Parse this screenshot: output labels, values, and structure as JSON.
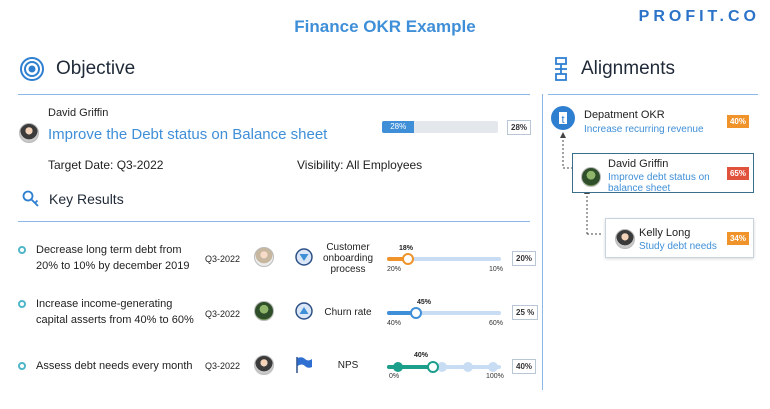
{
  "page": {
    "title": "Finance OKR Example",
    "logo": "PROFIT.CO"
  },
  "objective": {
    "section_label": "Objective",
    "owner": "David Griffin",
    "title": "Improve the Debt status on Balance sheet",
    "progress": 28,
    "progress_label": "28%",
    "progress_box": "28%",
    "target_date_label": "Target Date:",
    "target_date": "Q3-2022",
    "visibility_label": "Visibility:",
    "visibility": "All Employees"
  },
  "key_results": {
    "section_label": "Key Results",
    "items": [
      {
        "text": "Decrease long term debt from 20% to 10% by december 2019",
        "date": "Q3-2022",
        "icon": "arrow-down-circle-icon",
        "metric": "Customer onboarding process",
        "slider": {
          "value": 18,
          "value_label": "18%",
          "min_label": "20%",
          "max_label": "10%",
          "progress_fraction": 0.18,
          "color": "#f0932b"
        },
        "pct": "20%"
      },
      {
        "text": "Increase income-generating capital asserts from 40% to 60%",
        "date": "Q3-2022",
        "icon": "arrow-up-circle-icon",
        "metric": "Churn rate",
        "slider": {
          "value": 45,
          "value_label": "45%",
          "min_label": "40%",
          "max_label": "60%",
          "progress_fraction": 0.25,
          "color": "#3f8fd8"
        },
        "pct": "25 %"
      },
      {
        "text": "Assess debt needs every month",
        "date": "Q3-2022",
        "icon": "flag-icon",
        "metric": "NPS",
        "slider": {
          "value": 40,
          "value_label": "40%",
          "min_label": "0%",
          "max_label": "100%",
          "progress_fraction": 0.4,
          "color": "#1b9e8a"
        },
        "pct": "40%"
      }
    ]
  },
  "alignments": {
    "section_label": "Alignments",
    "items": [
      {
        "name": "Depatment OKR",
        "sub": "Increase recurring revenue",
        "badge": "40%",
        "badge_color": "#f0932b"
      },
      {
        "name": "David Griffin",
        "sub": "Improve debt status on balance sheet",
        "badge": "65%",
        "badge_color": "#e0523c"
      },
      {
        "name": "Kelly Long",
        "sub": "Study debt needs",
        "badge": "34%",
        "badge_color": "#f0932b"
      }
    ]
  }
}
